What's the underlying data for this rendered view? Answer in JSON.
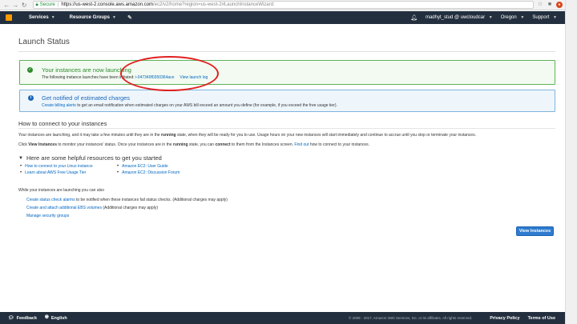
{
  "browser": {
    "secure_label": "Secure",
    "url_host": "https://us-west-2.console.aws.amazon.com",
    "url_rest": "/ec2/v2/home?region=us-west-2#LaunchInstanceWizard:"
  },
  "nav": {
    "services": "Services",
    "resource_groups": "Resource Groups",
    "user": "madhyt_stud @ uwcloudcar",
    "region": "Oregon",
    "support": "Support"
  },
  "page": {
    "title": "Launch Status"
  },
  "success": {
    "title": "Your instances are now launching",
    "text": "The following instance launches have been initiated:",
    "instance_id": "i-047349f0350364ace",
    "view_log": "View launch log"
  },
  "info": {
    "title": "Get notified of estimated charges",
    "link": "Create billing alerts",
    "text": "to get an email notification when estimated charges on your AWS bill exceed an amount you define (for example, if you exceed the free usage tier)."
  },
  "connect": {
    "heading": "How to connect to your instances",
    "p1_a": "Your instances are launching, and it may take a few minutes until they are in the",
    "p1_bold": "running",
    "p1_b": "state, when they will be ready for you to use. Usage hours on your new instances will start immediately and continue to accrue until you stop or terminate your instances.",
    "p2_a": "Click",
    "p2_bold1": "View Instances",
    "p2_b": "to monitor your instances' status. Once your instances are in the",
    "p2_bold2": "running",
    "p2_c": "state, you can",
    "p2_bold3": "connect",
    "p2_d": "to them from the Instances screen.",
    "p2_link": "Find out",
    "p2_e": "how to connect to your instances."
  },
  "resources": {
    "heading": "Here are some helpful resources to get you started",
    "col1": [
      "How to connect to your Linux instance",
      "Learn about AWS Free Usage Tier"
    ],
    "col2": [
      "Amazon EC2: User Guide",
      "Amazon EC2: Discussion Forum"
    ]
  },
  "also": {
    "intro": "While your instances are launching you can also",
    "item1_link": "Create status check alarms",
    "item1_text": "to be notified when these instances fail status checks. (Additional charges may apply)",
    "item2_link": "Create and attach additional EBS volumes",
    "item2_text": "(Additional charges may apply)",
    "item3_link": "Manage security groups"
  },
  "buttons": {
    "view_instances": "View Instances"
  },
  "footer": {
    "feedback": "Feedback",
    "language": "English",
    "copyright": "© 2008 - 2017, Amazon Web Services, Inc. or its affiliates. All rights reserved.",
    "privacy": "Privacy Policy",
    "terms": "Terms of Use"
  },
  "colors": {
    "aws_nav": "#232f3e",
    "aws_orange": "#ff9900",
    "success_green": "#2e8b2e",
    "info_blue": "#1b66b8",
    "link_blue": "#0066c0",
    "annotation_red": "#e02020"
  }
}
